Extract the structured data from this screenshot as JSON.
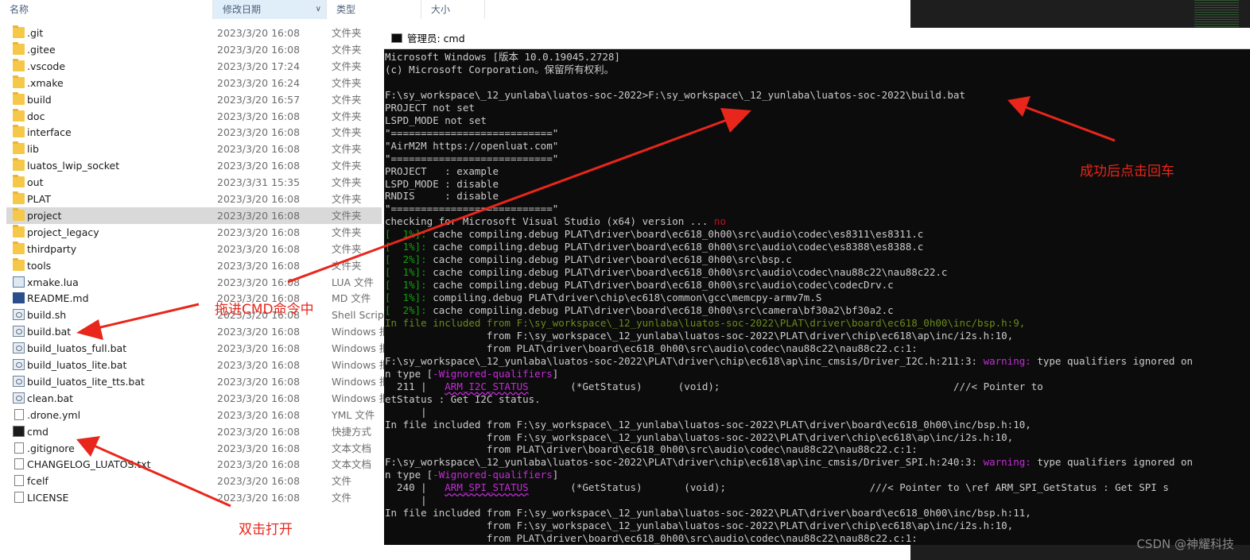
{
  "explorer": {
    "columns": {
      "name": "名称",
      "date": "修改日期",
      "type": "类型",
      "size": "大小"
    },
    "files": [
      {
        "name": ".git",
        "date": "2023/3/20 16:08",
        "type": "文件夹",
        "icon": "folder-icon"
      },
      {
        "name": ".gitee",
        "date": "2023/3/20 16:08",
        "type": "文件夹",
        "icon": "folder-icon"
      },
      {
        "name": ".vscode",
        "date": "2023/3/20 17:24",
        "type": "文件夹",
        "icon": "folder-icon"
      },
      {
        "name": ".xmake",
        "date": "2023/3/20 16:24",
        "type": "文件夹",
        "icon": "folder-icon"
      },
      {
        "name": "build",
        "date": "2023/3/20 16:57",
        "type": "文件夹",
        "icon": "folder-icon"
      },
      {
        "name": "doc",
        "date": "2023/3/20 16:08",
        "type": "文件夹",
        "icon": "folder-icon"
      },
      {
        "name": "interface",
        "date": "2023/3/20 16:08",
        "type": "文件夹",
        "icon": "folder-icon"
      },
      {
        "name": "lib",
        "date": "2023/3/20 16:08",
        "type": "文件夹",
        "icon": "folder-icon"
      },
      {
        "name": "luatos_lwip_socket",
        "date": "2023/3/20 16:08",
        "type": "文件夹",
        "icon": "folder-icon"
      },
      {
        "name": "out",
        "date": "2023/3/31 15:35",
        "type": "文件夹",
        "icon": "folder-icon"
      },
      {
        "name": "PLAT",
        "date": "2023/3/20 16:08",
        "type": "文件夹",
        "icon": "folder-icon"
      },
      {
        "name": "project",
        "date": "2023/3/20 16:08",
        "type": "文件夹",
        "icon": "folder-icon",
        "selected": true
      },
      {
        "name": "project_legacy",
        "date": "2023/3/20 16:08",
        "type": "文件夹",
        "icon": "folder-icon"
      },
      {
        "name": "thirdparty",
        "date": "2023/3/20 16:08",
        "type": "文件夹",
        "icon": "folder-icon"
      },
      {
        "name": "tools",
        "date": "2023/3/20 16:08",
        "type": "文件夹",
        "icon": "folder-icon"
      },
      {
        "name": "xmake.lua",
        "date": "2023/3/20 16:08",
        "type": "LUA 文件",
        "icon": "lua-file-icon"
      },
      {
        "name": "README.md",
        "date": "2023/3/20 16:08",
        "type": "MD 文件",
        "icon": "markdown-file-icon"
      },
      {
        "name": "build.sh",
        "date": "2023/3/20 16:08",
        "type": "Shell Script",
        "icon": "script-file-icon"
      },
      {
        "name": "build.bat",
        "date": "2023/3/20 16:08",
        "type": "Windows 批",
        "icon": "batch-file-icon"
      },
      {
        "name": "build_luatos_full.bat",
        "date": "2023/3/20 16:08",
        "type": "Windows 批",
        "icon": "batch-file-icon"
      },
      {
        "name": "build_luatos_lite.bat",
        "date": "2023/3/20 16:08",
        "type": "Windows 批",
        "icon": "batch-file-icon"
      },
      {
        "name": "build_luatos_lite_tts.bat",
        "date": "2023/3/20 16:08",
        "type": "Windows 批",
        "icon": "batch-file-icon"
      },
      {
        "name": "clean.bat",
        "date": "2023/3/20 16:08",
        "type": "Windows 批",
        "icon": "batch-file-icon"
      },
      {
        "name": ".drone.yml",
        "date": "2023/3/20 16:08",
        "type": "YML 文件",
        "icon": "file-icon"
      },
      {
        "name": "cmd",
        "date": "2023/3/20 16:08",
        "type": "快捷方式",
        "icon": "cmd-shortcut-icon"
      },
      {
        "name": ".gitignore",
        "date": "2023/3/20 16:08",
        "type": "文本文档",
        "icon": "text-file-icon"
      },
      {
        "name": "CHANGELOG_LUATOS.txt",
        "date": "2023/3/20 16:08",
        "type": "文本文档",
        "icon": "text-file-icon"
      },
      {
        "name": "fcelf",
        "date": "2023/3/20 16:08",
        "type": "文件",
        "icon": "file-icon"
      },
      {
        "name": "LICENSE",
        "date": "2023/3/20 16:08",
        "type": "文件",
        "icon": "file-icon"
      }
    ]
  },
  "cmd": {
    "title": "管理员: cmd",
    "lines": [
      [
        {
          "t": "Microsoft Windows [版本 10.0.19045.2728]"
        }
      ],
      [
        {
          "t": "(c) Microsoft Corporation。保留所有权利。"
        }
      ],
      [
        {
          "t": ""
        }
      ],
      [
        {
          "t": "F:\\sy_workspace\\_12_yunlaba\\luatos-soc-2022>F:\\sy_workspace\\_12_yunlaba\\luatos-soc-2022\\build.bat"
        }
      ],
      [
        {
          "t": "PROJECT not set"
        }
      ],
      [
        {
          "t": "LSPD_MODE not set"
        }
      ],
      [
        {
          "t": "\"===========================\""
        }
      ],
      [
        {
          "t": "\"AirM2M https://openluat.com\""
        }
      ],
      [
        {
          "t": "\"===========================\""
        }
      ],
      [
        {
          "t": "PROJECT   : example"
        }
      ],
      [
        {
          "t": "LSPD_MODE : disable"
        }
      ],
      [
        {
          "t": "RNDIS     : disable"
        }
      ],
      [
        {
          "t": "\"===========================\""
        }
      ],
      [
        {
          "t": "checking for Microsoft Visual Studio (x64) version ... "
        },
        {
          "t": "no",
          "c": "rd"
        }
      ],
      [
        {
          "t": "[  1%]:",
          "c": "g"
        },
        {
          "t": " cache compiling.debug PLAT\\driver\\board\\ec618_0h00\\src\\audio\\codec\\es8311\\es8311.c"
        }
      ],
      [
        {
          "t": "[  1%]:",
          "c": "g"
        },
        {
          "t": " cache compiling.debug PLAT\\driver\\board\\ec618_0h00\\src\\audio\\codec\\es8388\\es8388.c"
        }
      ],
      [
        {
          "t": "[  2%]:",
          "c": "g"
        },
        {
          "t": " cache compiling.debug PLAT\\driver\\board\\ec618_0h00\\src\\bsp.c"
        }
      ],
      [
        {
          "t": "[  1%]:",
          "c": "g"
        },
        {
          "t": " cache compiling.debug PLAT\\driver\\board\\ec618_0h00\\src\\audio\\codec\\nau88c22\\nau88c22.c"
        }
      ],
      [
        {
          "t": "[  1%]:",
          "c": "g"
        },
        {
          "t": " cache compiling.debug PLAT\\driver\\board\\ec618_0h00\\src\\audio\\codec\\codecDrv.c"
        }
      ],
      [
        {
          "t": "[  1%]:",
          "c": "g"
        },
        {
          "t": " compiling.debug PLAT\\driver\\chip\\ec618\\common\\gcc\\memcpy-armv7m.S"
        }
      ],
      [
        {
          "t": "[  2%]:",
          "c": "g"
        },
        {
          "t": " cache compiling.debug PLAT\\driver\\board\\ec618_0h00\\src\\camera\\bf30a2\\bf30a2.c"
        }
      ],
      [
        {
          "t": "In file included from F:\\sy_workspace\\_12_yunlaba\\luatos-soc-2022\\PLAT\\driver\\board\\ec618_0h00\\inc/bsp.h:9,",
          "c": "dg"
        }
      ],
      [
        {
          "t": "                 from F:\\sy_workspace\\_12_yunlaba\\luatos-soc-2022\\PLAT\\driver\\chip\\ec618\\ap\\inc/i2s.h:10,"
        }
      ],
      [
        {
          "t": "                 from PLAT\\driver\\board\\ec618_0h00\\src\\audio\\codec\\nau88c22\\nau88c22.c:1:"
        }
      ],
      [
        {
          "t": "F:\\sy_workspace\\_12_yunlaba\\luatos-soc-2022\\PLAT\\driver\\chip\\ec618\\ap\\inc_cmsis/Driver_I2C.h:211:3: "
        },
        {
          "t": "warning:",
          "c": "mg"
        },
        {
          "t": " type qualifiers ignored on"
        }
      ],
      [
        {
          "t": "n type ["
        },
        {
          "t": "-Wignored-qualifiers",
          "c": "mg"
        },
        {
          "t": "]"
        }
      ],
      [
        {
          "t": "  211 |   "
        },
        {
          "t": "ARM_I2C_STATUS",
          "c": "mg"
        },
        {
          "t": "       (*GetStatus)      (void);                                       ///< Pointer to"
        }
      ],
      [
        {
          "t": "etStatus : Get I2C status."
        }
      ],
      [
        {
          "t": "      |"
        }
      ],
      [
        {
          "t": "In file included from F:\\sy_workspace\\_12_yunlaba\\luatos-soc-2022\\PLAT\\driver\\board\\ec618_0h00\\inc/bsp.h:10,"
        }
      ],
      [
        {
          "t": "                 from F:\\sy_workspace\\_12_yunlaba\\luatos-soc-2022\\PLAT\\driver\\chip\\ec618\\ap\\inc/i2s.h:10,"
        }
      ],
      [
        {
          "t": "                 from PLAT\\driver\\board\\ec618_0h00\\src\\audio\\codec\\nau88c22\\nau88c22.c:1:"
        }
      ],
      [
        {
          "t": "F:\\sy_workspace\\_12_yunlaba\\luatos-soc-2022\\PLAT\\driver\\chip\\ec618\\ap\\inc_cmsis/Driver_SPI.h:240:3: "
        },
        {
          "t": "warning:",
          "c": "mg"
        },
        {
          "t": " type qualifiers ignored on"
        }
      ],
      [
        {
          "t": "n type ["
        },
        {
          "t": "-Wignored-qualifiers",
          "c": "mg"
        },
        {
          "t": "]"
        }
      ],
      [
        {
          "t": "  240 |   "
        },
        {
          "t": "ARM_SPI_STATUS",
          "c": "mg"
        },
        {
          "t": "       (*GetStatus)       (void);                        ///< Pointer to \\ref ARM_SPI_GetStatus : Get SPI s"
        }
      ],
      [
        {
          "t": "      |"
        }
      ],
      [
        {
          "t": "In file included from F:\\sy_workspace\\_12_yunlaba\\luatos-soc-2022\\PLAT\\driver\\board\\ec618_0h00\\inc/bsp.h:11,"
        }
      ],
      [
        {
          "t": "                 from F:\\sy_workspace\\_12_yunlaba\\luatos-soc-2022\\PLAT\\driver\\chip\\ec618\\ap\\inc/i2s.h:10,"
        }
      ],
      [
        {
          "t": "                 from PLAT\\driver\\board\\ec618_0h00\\src\\audio\\codec\\nau88c22\\nau88c22.c:1:"
        }
      ]
    ]
  },
  "annotations": {
    "enter_note": "成功后点击回车",
    "drag_note": "拖进CMD命令中",
    "open_note": "双击打开"
  },
  "watermark": "CSDN @神耀科技",
  "colors": {
    "annotation": "#e8261b",
    "console_bg": "#0c0c0c",
    "folder": "#f5c84a",
    "selected_row": "#d9d9d9"
  }
}
